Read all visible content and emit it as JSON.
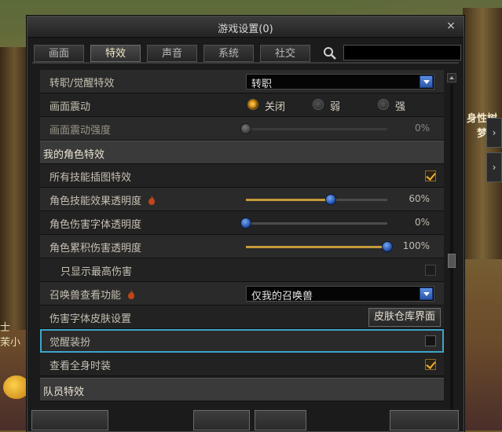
{
  "dialog": {
    "title": "游戏设置(0)",
    "close_glyph": "×"
  },
  "tabs": [
    {
      "label": "画面",
      "active": false
    },
    {
      "label": "特效",
      "active": true
    },
    {
      "label": "声音",
      "active": false
    },
    {
      "label": "系统",
      "active": false
    },
    {
      "label": "社交",
      "active": false
    }
  ],
  "search": {
    "value": "",
    "icon": "search-icon"
  },
  "settings": {
    "job_effect": {
      "label": "转职/觉醒特效",
      "value": "转职"
    },
    "screen_shake": {
      "label": "画面震动",
      "options": [
        "关闭",
        "弱",
        "强"
      ],
      "selected": "关闭"
    },
    "shake_strength": {
      "label": "画面震动强度",
      "percent": "0%",
      "level": 0
    },
    "my_char_header": "我的角色特效",
    "all_skill_art": {
      "label": "所有技能插图特效",
      "checked": true
    },
    "skill_effect_transparency": {
      "label": "角色技能效果透明度",
      "percent": "60%",
      "level": 0.6
    },
    "damage_font_transparency": {
      "label": "角色伤害字体透明度",
      "percent": "0%",
      "level": 0
    },
    "cumulative_damage_transparency": {
      "label": "角色累积伤害透明度",
      "percent": "100%",
      "level": 1
    },
    "show_max_damage": {
      "label": "只显示最高伤害",
      "checked": false
    },
    "summon_view": {
      "label": "召唤兽查看功能",
      "value": "仅我的召唤兽"
    },
    "damage_font_skin": {
      "label": "伤害字体皮肤设置",
      "button": "皮肤仓库界面"
    },
    "awaken_outfit": {
      "label": "觉醒装扮",
      "checked": false
    },
    "view_full_outfit": {
      "label": "查看全身时装",
      "checked": true
    },
    "team_header": "队员特效"
  },
  "background": {
    "left_text": "士\n茉小",
    "right_text": "身性树\n梦世"
  },
  "colors": {
    "accent_gold": "#f0b030",
    "selection_blue": "#3fa4c8",
    "dropdown_blue": "#2a55a8"
  }
}
